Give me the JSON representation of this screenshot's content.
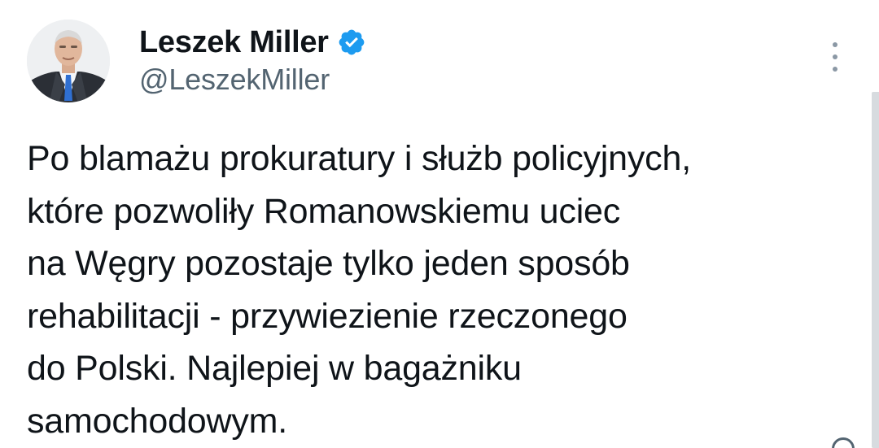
{
  "author": {
    "display_name": "Leszek Miller",
    "handle": "@LeszekMiller",
    "verified": true,
    "verified_icon": "verified-badge-icon",
    "avatar": "profile-photo-avatar"
  },
  "tweet": {
    "lines": [
      "Po blamażu prokuratury i służb policyjnych,",
      "które pozwoliły Romanowskiemu uciec",
      "na Węgry pozostaje tylko jeden sposób",
      "rehabilitacji - przywiezienie rzeczonego",
      "do Polski. Najlepiej w bagażniku",
      "samochodowym."
    ]
  },
  "menu": {
    "icon": "more-vertical-icon"
  },
  "colors": {
    "text": "#0f1419",
    "secondary": "#536471",
    "verified": "#1d9bf0",
    "background": "#ffffff"
  }
}
